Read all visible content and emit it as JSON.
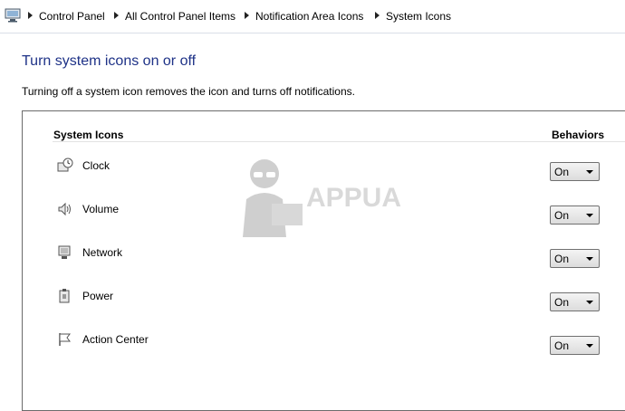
{
  "breadcrumb": {
    "items": [
      {
        "label": "Control Panel"
      },
      {
        "label": "All Control Panel Items"
      },
      {
        "label": "Notification Area Icons"
      },
      {
        "label": "System Icons"
      }
    ]
  },
  "page": {
    "title": "Turn system icons on or off",
    "description": "Turning off a system icon removes the icon and turns off notifications."
  },
  "table": {
    "column_icons": "System Icons",
    "column_behaviors": "Behaviors",
    "rows": [
      {
        "icon": "clock-icon",
        "label": "Clock",
        "behavior": "On"
      },
      {
        "icon": "volume-icon",
        "label": "Volume",
        "behavior": "On"
      },
      {
        "icon": "network-icon",
        "label": "Network",
        "behavior": "On"
      },
      {
        "icon": "power-icon",
        "label": "Power",
        "behavior": "On"
      },
      {
        "icon": "flag-icon",
        "label": "Action Center",
        "behavior": "On"
      }
    ]
  },
  "watermark": {
    "text": "APPUALS"
  },
  "colors": {
    "title": "#1e3287",
    "panel_border": "#6b6b6b"
  }
}
